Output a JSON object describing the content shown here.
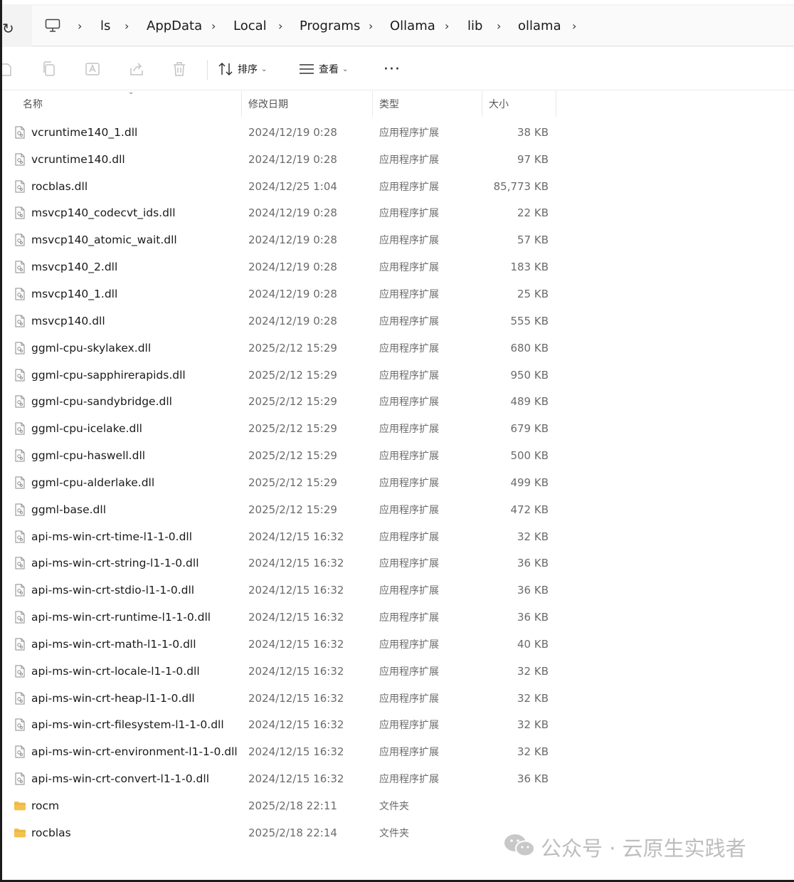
{
  "breadcrumb": {
    "items": [
      "ls",
      "AppData",
      "Local",
      "Programs",
      "Ollama",
      "lib",
      "ollama"
    ]
  },
  "toolbar": {
    "sort_label": "排序",
    "view_label": "查看",
    "more_label": "···"
  },
  "columns": {
    "name": "名称",
    "date": "修改日期",
    "type": "类型",
    "size": "大小"
  },
  "files": [
    {
      "name": "vcruntime140_1.dll",
      "date": "2024/12/19 0:28",
      "type": "应用程序扩展",
      "size": "38 KB",
      "kind": "file"
    },
    {
      "name": "vcruntime140.dll",
      "date": "2024/12/19 0:28",
      "type": "应用程序扩展",
      "size": "97 KB",
      "kind": "file"
    },
    {
      "name": "rocblas.dll",
      "date": "2024/12/25 1:04",
      "type": "应用程序扩展",
      "size": "85,773 KB",
      "kind": "file"
    },
    {
      "name": "msvcp140_codecvt_ids.dll",
      "date": "2024/12/19 0:28",
      "type": "应用程序扩展",
      "size": "22 KB",
      "kind": "file"
    },
    {
      "name": "msvcp140_atomic_wait.dll",
      "date": "2024/12/19 0:28",
      "type": "应用程序扩展",
      "size": "57 KB",
      "kind": "file"
    },
    {
      "name": "msvcp140_2.dll",
      "date": "2024/12/19 0:28",
      "type": "应用程序扩展",
      "size": "183 KB",
      "kind": "file"
    },
    {
      "name": "msvcp140_1.dll",
      "date": "2024/12/19 0:28",
      "type": "应用程序扩展",
      "size": "25 KB",
      "kind": "file"
    },
    {
      "name": "msvcp140.dll",
      "date": "2024/12/19 0:28",
      "type": "应用程序扩展",
      "size": "555 KB",
      "kind": "file"
    },
    {
      "name": "ggml-cpu-skylakex.dll",
      "date": "2025/2/12 15:29",
      "type": "应用程序扩展",
      "size": "680 KB",
      "kind": "file"
    },
    {
      "name": "ggml-cpu-sapphirerapids.dll",
      "date": "2025/2/12 15:29",
      "type": "应用程序扩展",
      "size": "950 KB",
      "kind": "file"
    },
    {
      "name": "ggml-cpu-sandybridge.dll",
      "date": "2025/2/12 15:29",
      "type": "应用程序扩展",
      "size": "489 KB",
      "kind": "file"
    },
    {
      "name": "ggml-cpu-icelake.dll",
      "date": "2025/2/12 15:29",
      "type": "应用程序扩展",
      "size": "679 KB",
      "kind": "file"
    },
    {
      "name": "ggml-cpu-haswell.dll",
      "date": "2025/2/12 15:29",
      "type": "应用程序扩展",
      "size": "500 KB",
      "kind": "file"
    },
    {
      "name": "ggml-cpu-alderlake.dll",
      "date": "2025/2/12 15:29",
      "type": "应用程序扩展",
      "size": "499 KB",
      "kind": "file"
    },
    {
      "name": "ggml-base.dll",
      "date": "2025/2/12 15:29",
      "type": "应用程序扩展",
      "size": "472 KB",
      "kind": "file"
    },
    {
      "name": "api-ms-win-crt-time-l1-1-0.dll",
      "date": "2024/12/15 16:32",
      "type": "应用程序扩展",
      "size": "32 KB",
      "kind": "file"
    },
    {
      "name": "api-ms-win-crt-string-l1-1-0.dll",
      "date": "2024/12/15 16:32",
      "type": "应用程序扩展",
      "size": "36 KB",
      "kind": "file"
    },
    {
      "name": "api-ms-win-crt-stdio-l1-1-0.dll",
      "date": "2024/12/15 16:32",
      "type": "应用程序扩展",
      "size": "36 KB",
      "kind": "file"
    },
    {
      "name": "api-ms-win-crt-runtime-l1-1-0.dll",
      "date": "2024/12/15 16:32",
      "type": "应用程序扩展",
      "size": "36 KB",
      "kind": "file"
    },
    {
      "name": "api-ms-win-crt-math-l1-1-0.dll",
      "date": "2024/12/15 16:32",
      "type": "应用程序扩展",
      "size": "40 KB",
      "kind": "file"
    },
    {
      "name": "api-ms-win-crt-locale-l1-1-0.dll",
      "date": "2024/12/15 16:32",
      "type": "应用程序扩展",
      "size": "32 KB",
      "kind": "file"
    },
    {
      "name": "api-ms-win-crt-heap-l1-1-0.dll",
      "date": "2024/12/15 16:32",
      "type": "应用程序扩展",
      "size": "32 KB",
      "kind": "file"
    },
    {
      "name": "api-ms-win-crt-filesystem-l1-1-0.dll",
      "date": "2024/12/15 16:32",
      "type": "应用程序扩展",
      "size": "32 KB",
      "kind": "file"
    },
    {
      "name": "api-ms-win-crt-environment-l1-1-0.dll",
      "date": "2024/12/15 16:32",
      "type": "应用程序扩展",
      "size": "32 KB",
      "kind": "file"
    },
    {
      "name": "api-ms-win-crt-convert-l1-1-0.dll",
      "date": "2024/12/15 16:32",
      "type": "应用程序扩展",
      "size": "36 KB",
      "kind": "file"
    },
    {
      "name": "rocm",
      "date": "2025/2/18 22:11",
      "type": "文件夹",
      "size": "",
      "kind": "folder"
    },
    {
      "name": "rocblas",
      "date": "2025/2/18 22:14",
      "type": "文件夹",
      "size": "",
      "kind": "folder"
    }
  ],
  "watermark": {
    "text": "公众号 · 云原生实践者"
  },
  "colors": {
    "folder": "#f2c14e",
    "address_bar_bg": "#f3f3f3",
    "secondary_text": "#6b6b6b"
  }
}
